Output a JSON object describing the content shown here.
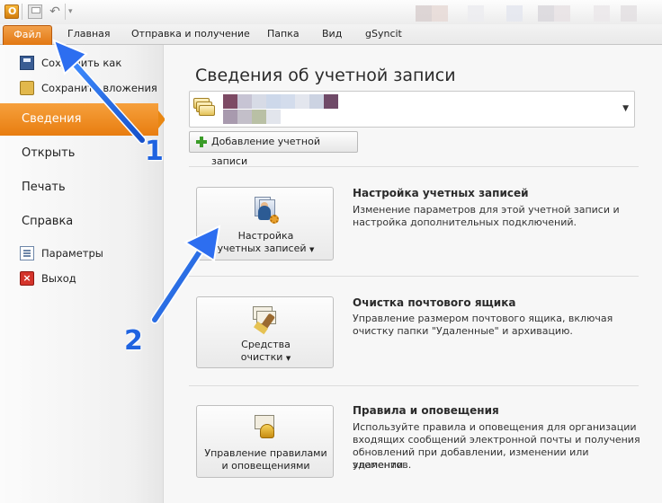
{
  "tabs": {
    "file": "Файл",
    "home": "Главная",
    "send_receive": "Отправка и получение",
    "folder": "Папка",
    "view": "Вид",
    "gsyncit": "gSyncit"
  },
  "nav": {
    "save_as": "Сохранить как",
    "save_attachments": "Сохранить вложения",
    "info": "Сведения",
    "open": "Открыть",
    "print": "Печать",
    "help": "Справка",
    "options": "Параметры",
    "exit": "Выход"
  },
  "main": {
    "title": "Сведения об учетной записи",
    "add_account": "Добавление учетной записи",
    "sections": [
      {
        "button_line1": "Настройка",
        "button_line2": "учетных записей",
        "title": "Настройка учетных записей",
        "desc_line1": "Изменение параметров для этой учетной записи и",
        "desc_line2": "настройка дополнительных подключений."
      },
      {
        "button_line1": "Средства",
        "button_line2": "очистки",
        "title": "Очистка почтового ящика",
        "desc_line1": "Управление размером почтового ящика, включая",
        "desc_line2": "очистку папки \"Удаленные\" и архивацию."
      },
      {
        "button_line1": "Управление правилами",
        "button_line2": "и оповещениями",
        "title": "Правила и оповещения",
        "desc_line1": "Используйте правила и оповещения для организации",
        "desc_line2": "входящих сообщений электронной почты и получения",
        "desc_line3": "обновлений при добавлении, изменении или удалении",
        "desc_line4": "элементов."
      }
    ]
  },
  "annotations": {
    "step1": "1",
    "step2": "2"
  },
  "colors": {
    "accent_orange": "#e87d10",
    "arrow_blue": "#1f63e0"
  }
}
